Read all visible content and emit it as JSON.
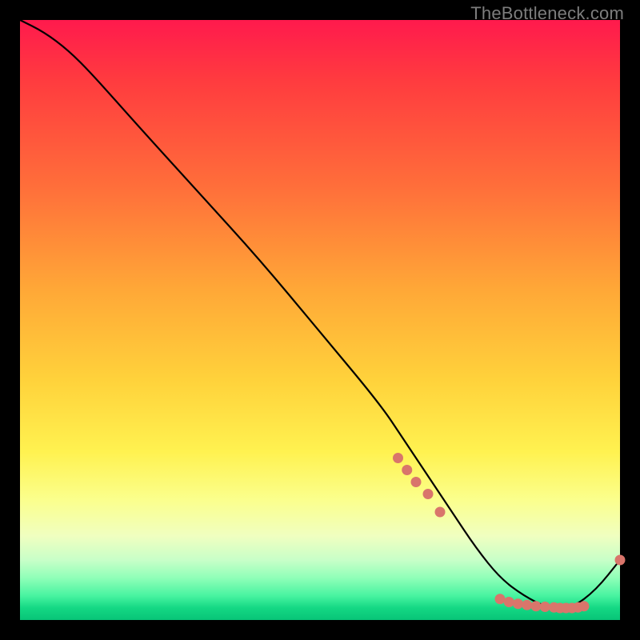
{
  "watermark": "TheBottleneck.com",
  "chart_data": {
    "type": "line",
    "title": "",
    "xlabel": "",
    "ylabel": "",
    "xlim": [
      0,
      100
    ],
    "ylim": [
      0,
      100
    ],
    "grid": false,
    "legend": false,
    "series": [
      {
        "name": "curve",
        "x": [
          0,
          4,
          8,
          12,
          20,
          30,
          40,
          50,
          60,
          64,
          68,
          72,
          76,
          80,
          84,
          88,
          92,
          96,
          100
        ],
        "y": [
          100,
          98,
          95,
          91,
          82,
          71,
          60,
          48,
          36,
          30,
          24,
          18,
          12,
          7,
          4,
          2,
          2,
          5,
          10
        ]
      }
    ],
    "markers": {
      "name": "points",
      "x": [
        63,
        64.5,
        66,
        68,
        70,
        80,
        81.5,
        83,
        84.5,
        86,
        87.5,
        89,
        90,
        91,
        92,
        93,
        94,
        100
      ],
      "y": [
        27,
        25,
        23,
        21,
        18,
        3.5,
        3,
        2.7,
        2.5,
        2.3,
        2.2,
        2.1,
        2.0,
        2.0,
        2.0,
        2.1,
        2.3,
        10
      ]
    }
  }
}
